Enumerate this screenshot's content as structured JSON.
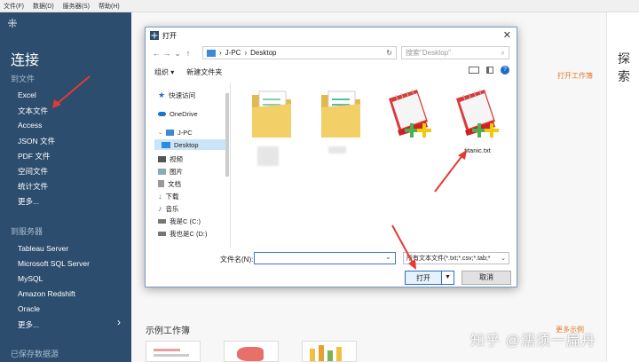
{
  "menubar": [
    "文件(F)",
    "数据(D)",
    "服务器(S)",
    "帮助(H)"
  ],
  "sidebar": {
    "title": "连接",
    "to_file": "到文件",
    "file_items": [
      "Excel",
      "文本文件",
      "Access",
      "JSON 文件",
      "PDF 文件",
      "空间文件",
      "统计文件",
      "更多..."
    ],
    "to_server": "到服务器",
    "server_items": [
      "Tableau Server",
      "Microsoft SQL Server",
      "MySQL",
      "Amazon Redshift",
      "Oracle",
      "更多..."
    ],
    "saved": "已保存数据源",
    "chevron": "›"
  },
  "main": {
    "sample_title": "示例工作簿",
    "explore": "探索",
    "open_workbook": "打开工作簿",
    "more_samples": "更多示例",
    "watermark": "知乎 @濡须一扁舟"
  },
  "dialog": {
    "title": "打开",
    "close": "✕",
    "path_root": "J-PC",
    "path_current": "Desktop",
    "search_placeholder": "搜索\"Desktop\"",
    "organize": "组织 ▾",
    "new_folder": "新建文件夹",
    "tree": [
      {
        "label": "快速访问",
        "icon": "star-icon"
      },
      {
        "label": "OneDrive",
        "icon": "cloud-icon"
      },
      {
        "label": "J-PC",
        "icon": "computer-icon"
      },
      {
        "label": "Desktop",
        "icon": "desktop-icon"
      },
      {
        "label": "视频",
        "icon": "video-icon"
      },
      {
        "label": "图片",
        "icon": "picture-icon"
      },
      {
        "label": "文档",
        "icon": "document-icon"
      },
      {
        "label": "下载",
        "icon": "download-icon"
      },
      {
        "label": "音乐",
        "icon": "music-icon"
      },
      {
        "label": "我是C (C:)",
        "icon": "drive-icon"
      },
      {
        "label": "我也是C (D:)",
        "icon": "drive-icon"
      }
    ],
    "file_caption": "titanic.txt",
    "filename_label": "文件名(N):",
    "filename_value": "",
    "filetype": "所有文本文件(*.txt;*.csv;*.tab;*",
    "open_btn": "打开",
    "cancel_btn": "取消"
  }
}
